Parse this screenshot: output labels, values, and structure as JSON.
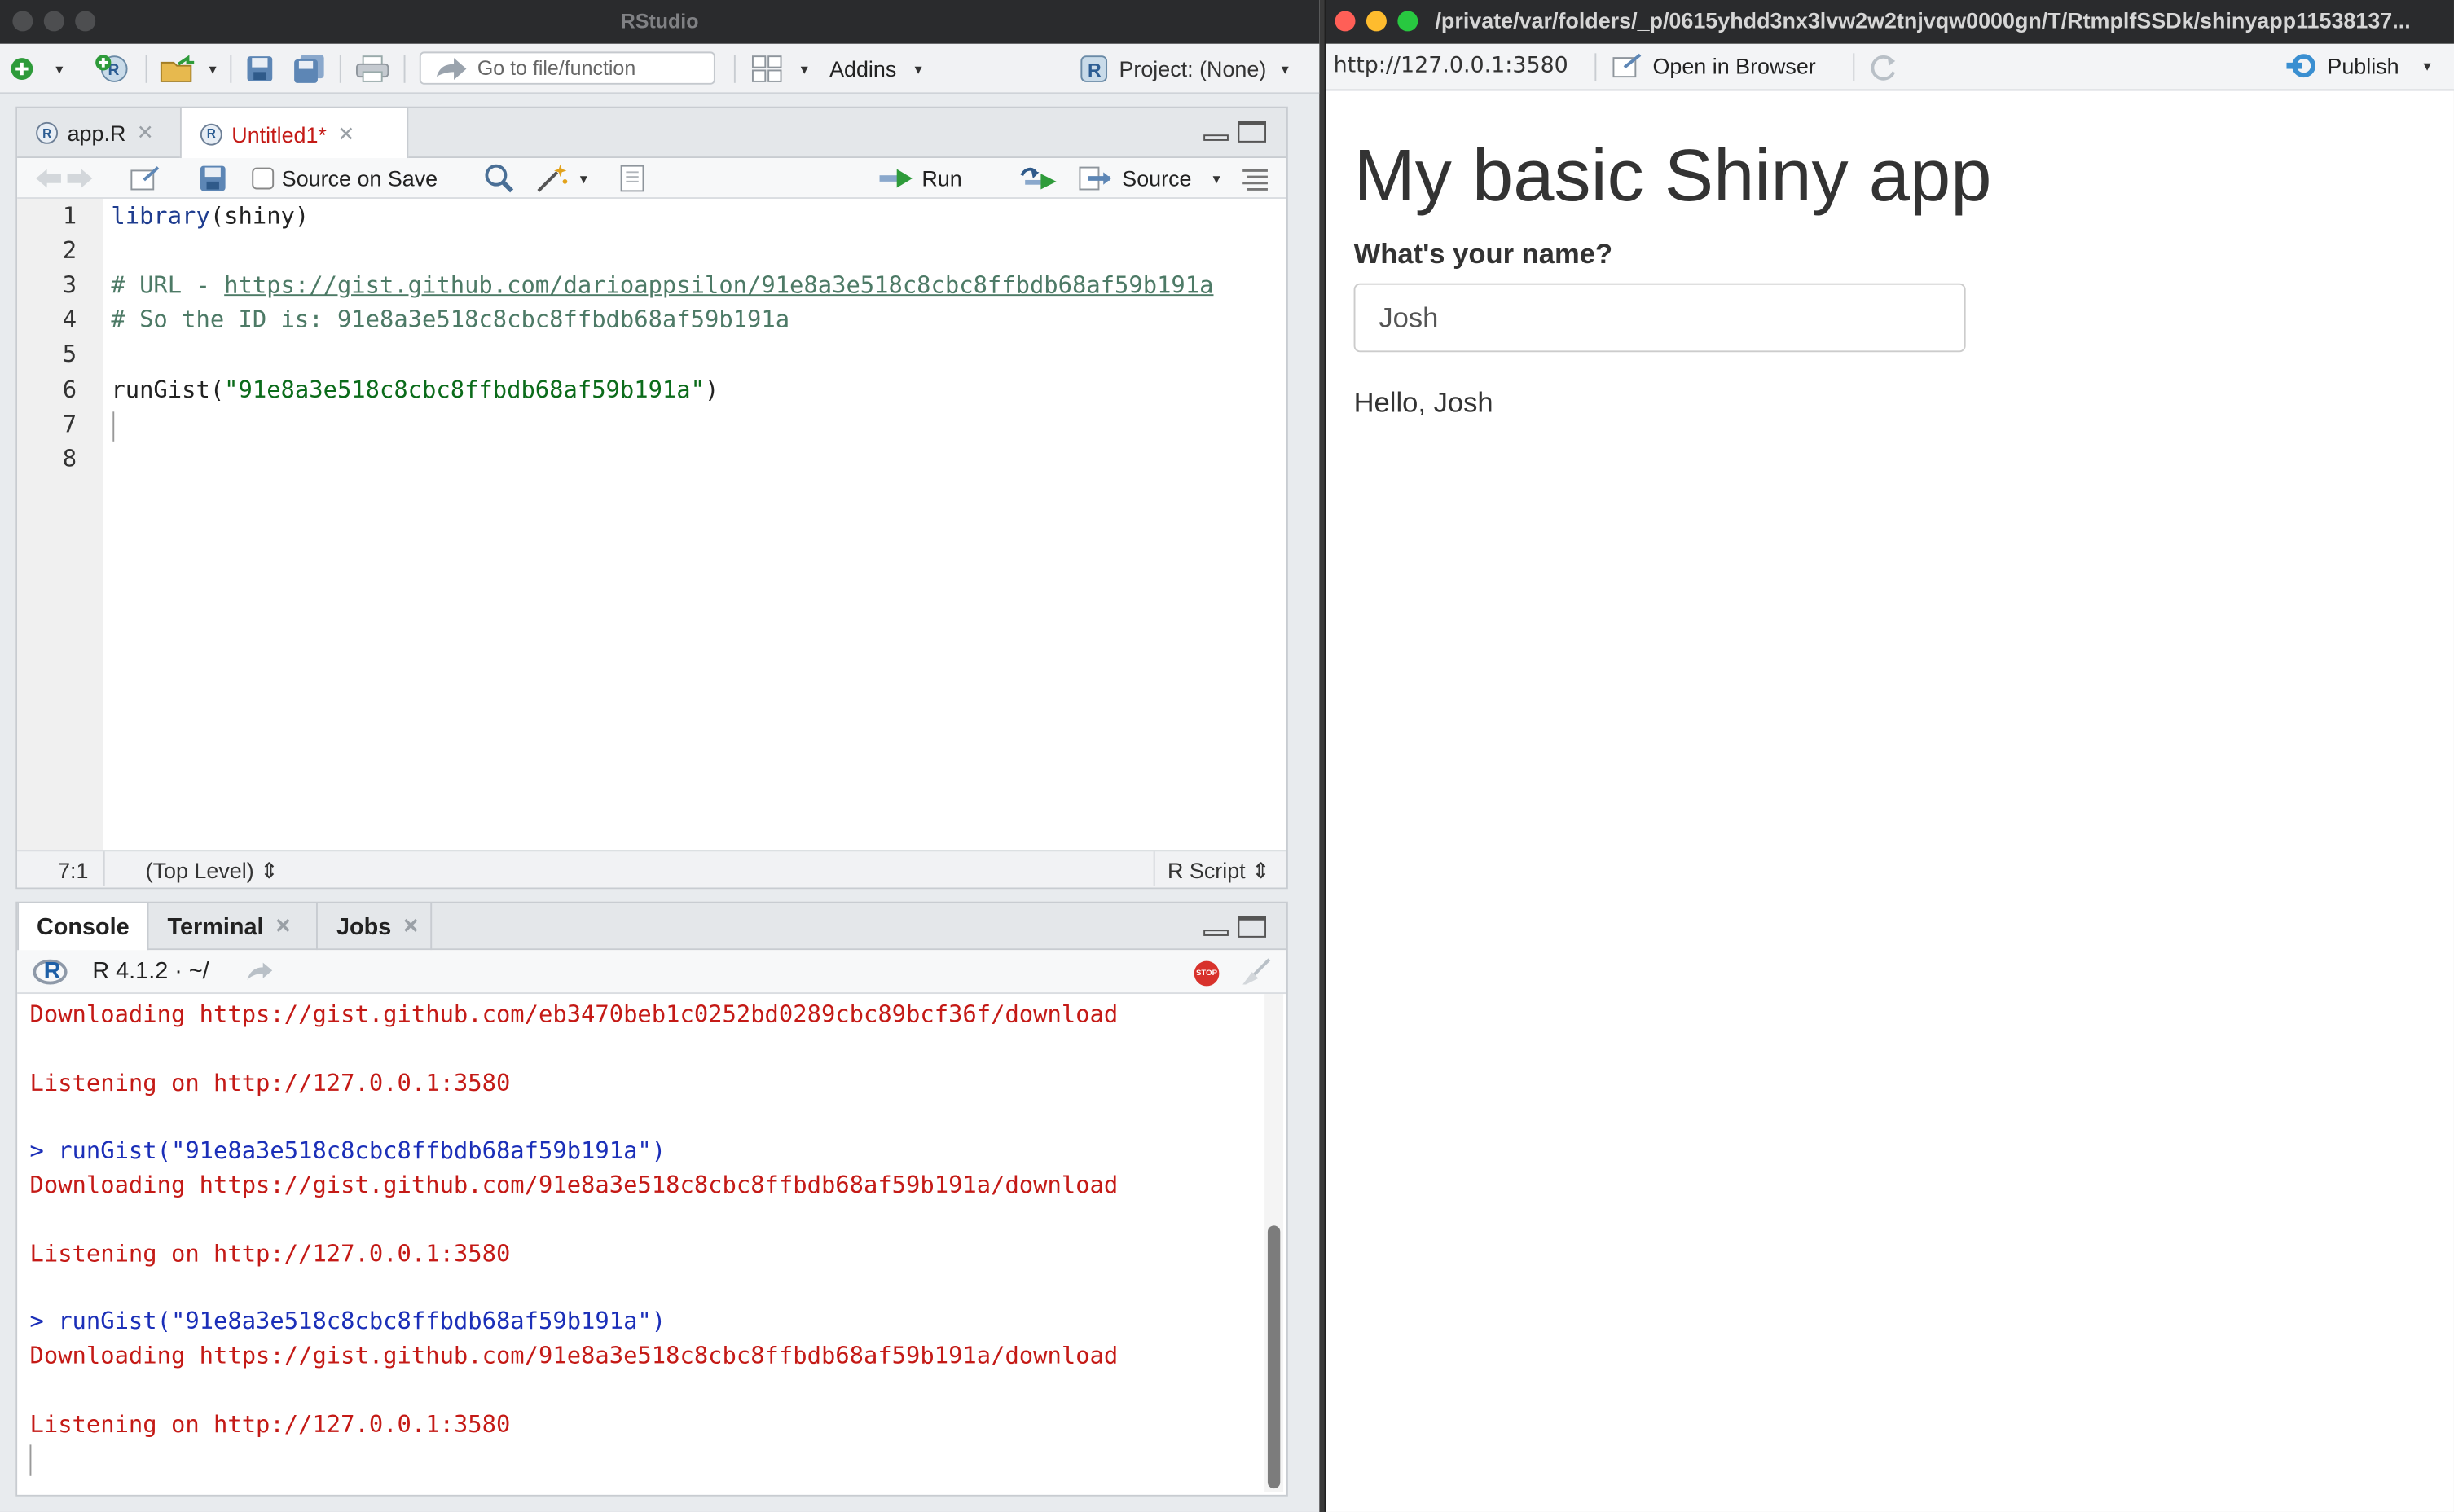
{
  "rstudio": {
    "window_title": "RStudio",
    "toolbar": {
      "goto_placeholder": "Go to file/function",
      "addins_label": "Addins",
      "project_label": "Project: (None)"
    },
    "editor": {
      "tabs": [
        {
          "label": "app.R",
          "modified": false,
          "active": false
        },
        {
          "label": "Untitled1*",
          "modified": true,
          "active": true
        }
      ],
      "source_on_save_label": "Source on Save",
      "run_label": "Run",
      "source_label": "Source",
      "line_numbers": [
        "1",
        "2",
        "3",
        "4",
        "5",
        "6",
        "7",
        "8"
      ],
      "code": {
        "l1_fn": "library",
        "l1_rest": "(shiny)",
        "l3_prefix": "# URL - ",
        "l3_link": "https://gist.github.com/darioappsilon/91e8a3e518c8cbc8ffbdb68af59b191a",
        "l4": "# So the ID is: 91e8a3e518c8cbc8ffbdb68af59b191a",
        "l6_fn": "runGist(",
        "l6_str": "\"91e8a3e518c8cbc8ffbdb68af59b191a\"",
        "l6_end": ")"
      },
      "status": {
        "position": "7:1",
        "scope": "(Top Level) ⇕",
        "file_type": "R Script ⇕"
      }
    },
    "console": {
      "tabs": [
        "Console",
        "Terminal",
        "Jobs"
      ],
      "r_version": "R 4.1.2 · ~/",
      "lines": [
        {
          "text": "Downloading https://gist.github.com/eb3470beb1c0252bd0289cbc89bcf36f/download",
          "kind": "output"
        },
        {
          "text": "Listening on http://127.0.0.1:3580",
          "kind": "output"
        },
        {
          "text": "> runGist(\"91e8a3e518c8cbc8ffbdb68af59b191a\")",
          "kind": "input"
        },
        {
          "text": "Downloading https://gist.github.com/91e8a3e518c8cbc8ffbdb68af59b191a/download",
          "kind": "output"
        },
        {
          "text": "Listening on http://127.0.0.1:3580",
          "kind": "output"
        },
        {
          "text": "> runGist(\"91e8a3e518c8cbc8ffbdb68af59b191a\")",
          "kind": "input"
        },
        {
          "text": "Downloading https://gist.github.com/91e8a3e518c8cbc8ffbdb68af59b191a/download",
          "kind": "output"
        },
        {
          "text": "Listening on http://127.0.0.1:3580",
          "kind": "output"
        }
      ]
    }
  },
  "viewer": {
    "window_title": "/private/var/folders/_p/0615yhdd3nx3lvw2w2tnjvqw0000gn/T/RtmplfSSDk/shinyapp11538137...",
    "url": "http://127.0.0.1:3580",
    "open_in_browser_label": "Open in Browser",
    "publish_label": "Publish",
    "app": {
      "title": "My basic Shiny app",
      "input_label": "What's your name?",
      "input_value": "Josh",
      "greeting": "Hello, Josh"
    }
  },
  "colors": {
    "output_text": "#c41a16",
    "input_text": "#1b2fb8",
    "string": "#0b6b1a",
    "comment": "#4d7a66",
    "keyword": "#1e3c8f",
    "stop_button": "#d8322c"
  }
}
